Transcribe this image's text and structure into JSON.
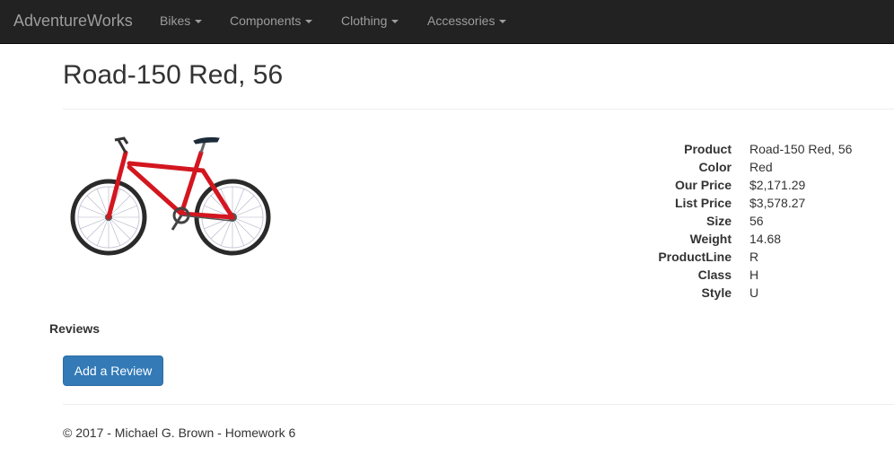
{
  "navbar": {
    "brand": "AdventureWorks",
    "items": [
      {
        "label": "Bikes"
      },
      {
        "label": "Components"
      },
      {
        "label": "Clothing"
      },
      {
        "label": "Accessories"
      }
    ]
  },
  "product": {
    "title": "Road-150 Red, 56",
    "image_icon": "red-road-bike-image",
    "bike_color": "#d3161f",
    "details": [
      {
        "term": "Product",
        "value": "Road-150 Red, 56"
      },
      {
        "term": "Color",
        "value": "Red"
      },
      {
        "term": "Our Price",
        "value": "$2,171.29"
      },
      {
        "term": "List Price",
        "value": "$3,578.27"
      },
      {
        "term": "Size",
        "value": "56"
      },
      {
        "term": "Weight",
        "value": "14.68"
      },
      {
        "term": "ProductLine",
        "value": "R"
      },
      {
        "term": "Class",
        "value": "H"
      },
      {
        "term": "Style",
        "value": "U"
      }
    ]
  },
  "reviews": {
    "heading": "Reviews",
    "add_button": "Add a Review"
  },
  "footer": {
    "text": "© 2017 - Michael G. Brown - Homework 6"
  },
  "colors": {
    "navbar_bg": "#222222",
    "nav_text": "#9d9d9d",
    "primary_button": "#337ab7"
  }
}
